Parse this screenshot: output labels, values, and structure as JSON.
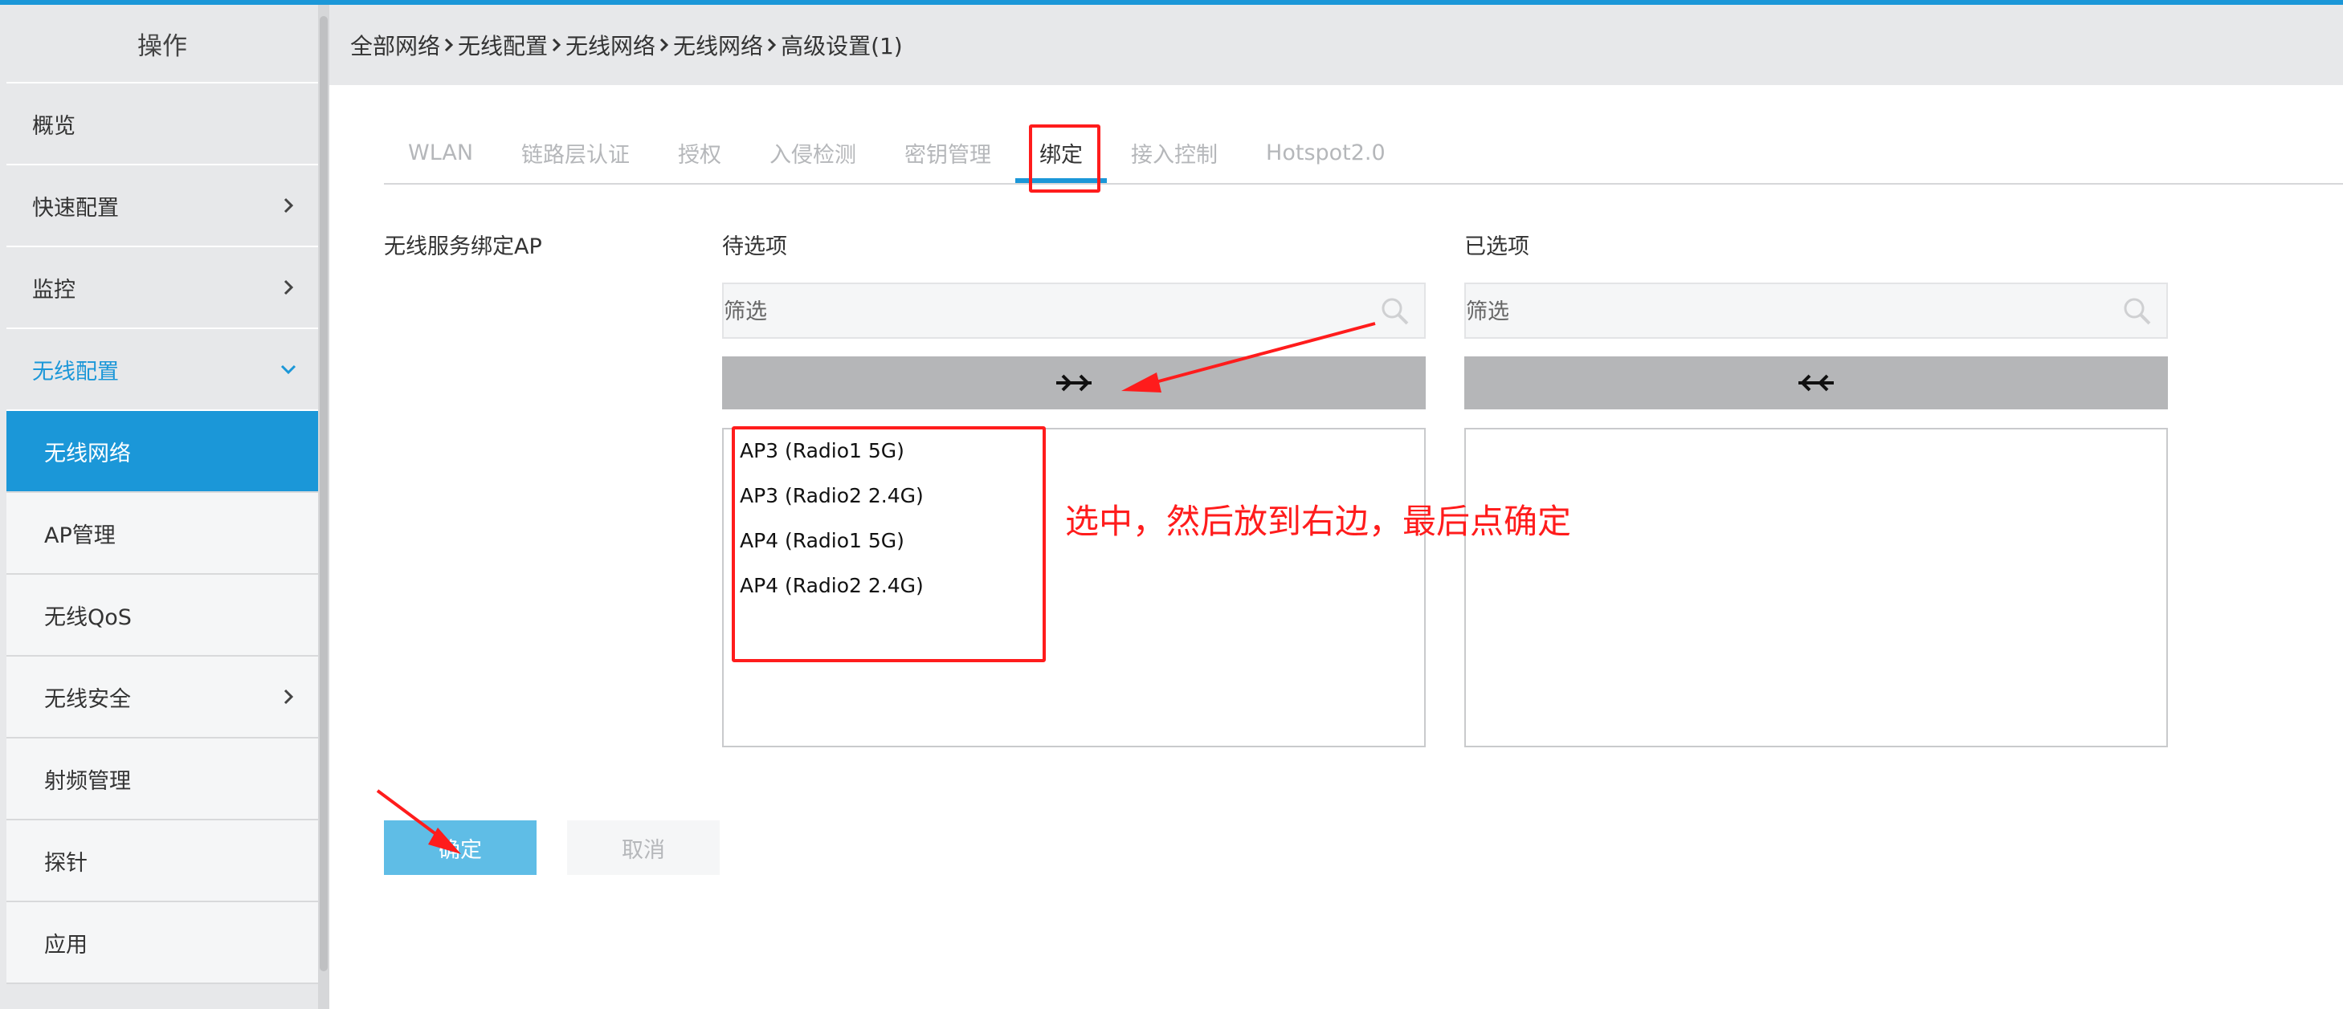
{
  "sidebar": {
    "header": "操作",
    "items": [
      {
        "label": "概览"
      },
      {
        "label": "快速配置"
      },
      {
        "label": "监控"
      },
      {
        "label": "无线配置"
      },
      {
        "label": "无线网络"
      },
      {
        "label": "AP管理"
      },
      {
        "label": "无线QoS"
      },
      {
        "label": "无线安全"
      },
      {
        "label": "射频管理"
      },
      {
        "label": "探针"
      },
      {
        "label": "应用"
      }
    ]
  },
  "breadcrumb": [
    "全部网络",
    "无线配置",
    "无线网络",
    "无线网络",
    "高级设置(1)"
  ],
  "tabs": [
    {
      "label": "WLAN"
    },
    {
      "label": "链路层认证"
    },
    {
      "label": "授权"
    },
    {
      "label": "入侵检测"
    },
    {
      "label": "密钥管理"
    },
    {
      "label": "绑定"
    },
    {
      "label": "接入控制"
    },
    {
      "label": "Hotspot2.0"
    }
  ],
  "form": {
    "field_label": "无线服务绑定AP",
    "available": {
      "title": "待选项",
      "filter_placeholder": "筛选",
      "items": [
        "AP3 (Radio1 5G)",
        "AP3 (Radio2 2.4G)",
        "AP4 (Radio1 5G)",
        "AP4 (Radio2 2.4G)"
      ]
    },
    "selected": {
      "title": "已选项",
      "filter_placeholder": "筛选",
      "items": []
    },
    "confirm_label": "确定",
    "cancel_label": "取消"
  },
  "annotation": {
    "text": "选中，然后放到右边，最后点确定"
  },
  "colors": {
    "accent": "#1b97d8",
    "confirm_button": "#5fbde6",
    "annotation": "#ff1c1c"
  },
  "icons": [
    "chevron-right-icon",
    "chevron-down-icon",
    "search-icon",
    "move-right-icon",
    "move-left-icon"
  ]
}
